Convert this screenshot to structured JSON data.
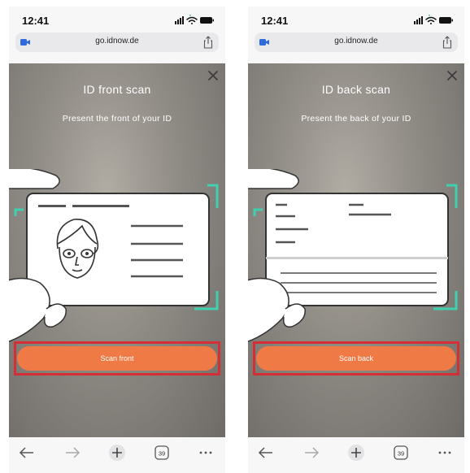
{
  "screens": [
    {
      "status": {
        "time": "12:41"
      },
      "browser": {
        "url": "go.idnow.de",
        "tab_count": "39"
      },
      "page": {
        "title": "ID front scan",
        "subtitle": "Present the front of your ID",
        "button_label": "Scan front"
      }
    },
    {
      "status": {
        "time": "12:41"
      },
      "browser": {
        "url": "go.idnow.de",
        "tab_count": "39"
      },
      "page": {
        "title": "ID back scan",
        "subtitle": "Present the back of your ID",
        "button_label": "Scan back"
      }
    }
  ],
  "icons": {
    "status": [
      "signal-icon",
      "wifi-icon",
      "battery-icon"
    ],
    "browser": [
      "camera-icon",
      "share-icon"
    ],
    "page": [
      "close-icon"
    ],
    "toolbar": [
      "back-arrow-icon",
      "forward-arrow-icon",
      "new-tab-icon",
      "tabs-icon",
      "more-icon"
    ]
  },
  "colors": {
    "button": "#f07a45",
    "highlight_border": "#d42f35",
    "frame_corners": "#3fd0b0",
    "camera_icon": "#2f6bdc",
    "background": "#8e8a84"
  }
}
